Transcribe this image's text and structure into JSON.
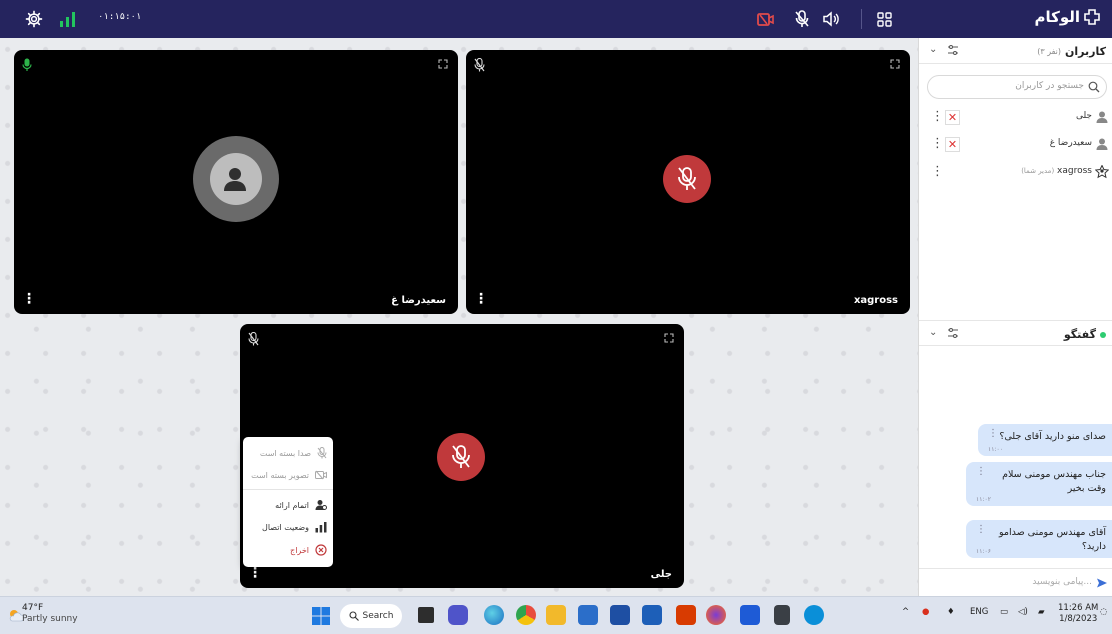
{
  "topbar": {
    "timer": "۰۱:۱۵:۰۱",
    "brand": "الوکام"
  },
  "tiles": [
    {
      "name": "سعیدرضا غ"
    },
    {
      "name": "xagross"
    },
    {
      "name": "جلی"
    }
  ],
  "context_menu": {
    "items": [
      {
        "label": "صدا بسته است",
        "icon": "mic-off-icon"
      },
      {
        "label": "تصویر بسته است",
        "icon": "camera-off-icon"
      },
      {
        "label": "اتمام ارائه",
        "icon": "presenter-icon"
      },
      {
        "label": "وضعیت اتصال",
        "icon": "signal-icon"
      },
      {
        "label": "اخراج",
        "icon": "kick-icon"
      }
    ]
  },
  "users_panel": {
    "title": "کاربران",
    "count": "(۳ نفر)",
    "search_placeholder": "جستجو در کاربران",
    "users": [
      {
        "name": "جلی",
        "tag": ""
      },
      {
        "name": "سعیدرضا غ",
        "tag": ""
      },
      {
        "name": "xagross",
        "tag": "(مدیر شما)"
      }
    ]
  },
  "chat_panel": {
    "title": "گفتگو",
    "messages": [
      {
        "text": "صدای منو دارید آقای جلی؟",
        "time": "۱۱:۰۰"
      },
      {
        "text": "جناب مهندس مومنی سلام وقت بخیر",
        "time": "۱۱:۰۲"
      },
      {
        "text": "آقای مهندس مومنی صدامو دارید؟",
        "time": "۱۱:۰۶"
      }
    ],
    "compose_placeholder": "پیامی بنویسید..."
  },
  "taskbar": {
    "temperature": "47°F",
    "condition": "Partly sunny",
    "search_label": "Search",
    "language": "ENG",
    "time": "11:26 AM",
    "date": "1/8/2023"
  },
  "colors": {
    "topbar": "#25245e",
    "muted_red": "#c0393b",
    "online_green": "#2ecc71",
    "signal_green": "#22c55e"
  }
}
